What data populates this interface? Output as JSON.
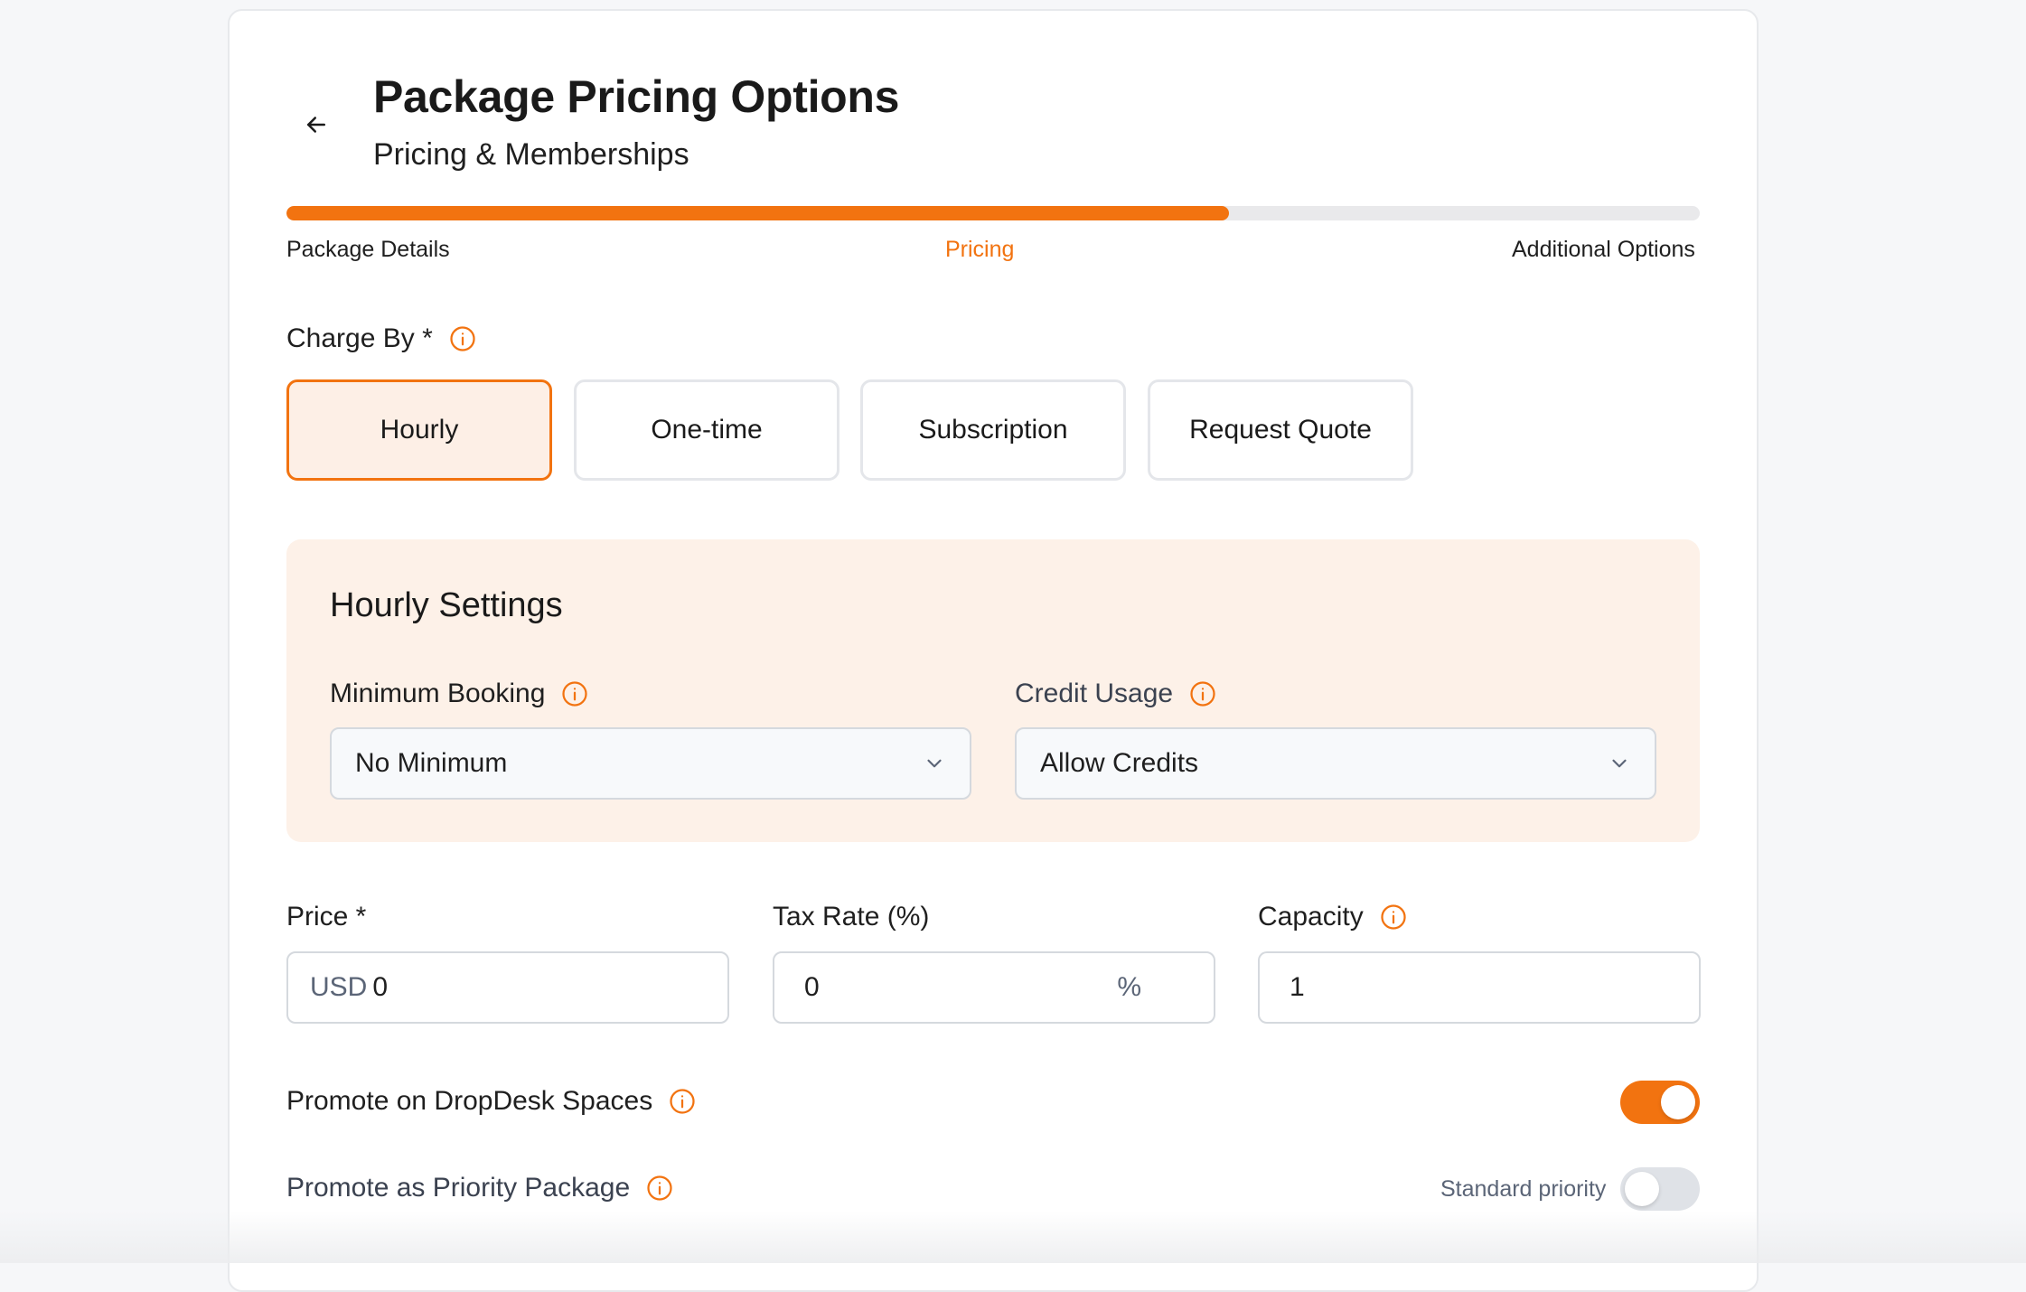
{
  "header": {
    "title": "Package Pricing Options",
    "subtitle": "Pricing & Memberships",
    "back_icon": "arrow-left-icon"
  },
  "progress": {
    "value_percent": 66.7,
    "steps": [
      {
        "label": "Package Details",
        "active": false
      },
      {
        "label": "Pricing",
        "active": true
      },
      {
        "label": "Additional Options",
        "active": false
      }
    ]
  },
  "charge_by": {
    "label": "Charge By *",
    "options": [
      "Hourly",
      "One-time",
      "Subscription",
      "Request Quote"
    ],
    "selected": "Hourly"
  },
  "hourly_settings": {
    "title": "Hourly Settings",
    "minimum_booking": {
      "label": "Minimum Booking",
      "value": "No Minimum"
    },
    "credit_usage": {
      "label": "Credit Usage",
      "value": "Allow Credits"
    }
  },
  "fields": {
    "price": {
      "label": "Price *",
      "prefix": "USD",
      "value": "0"
    },
    "tax_rate": {
      "label": "Tax Rate (%)",
      "value": "0",
      "suffix": "%"
    },
    "capacity": {
      "label": "Capacity",
      "value": "1"
    }
  },
  "promote": {
    "dropdesk_label": "Promote on DropDesk Spaces",
    "dropdesk_on": true,
    "priority_label": "Promote as Priority Package",
    "priority_note": "Standard priority",
    "priority_on": false
  },
  "colors": {
    "accent": "#f27310",
    "accent_light": "#fdf1e8",
    "border": "#d5d9de"
  }
}
